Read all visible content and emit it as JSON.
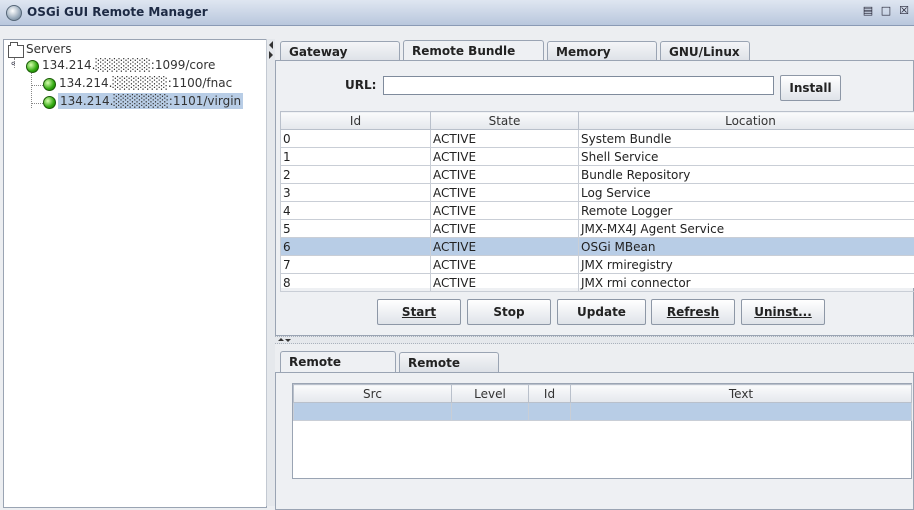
{
  "window": {
    "title": "OSGi GUI Remote Manager"
  },
  "tree": {
    "root_label": "Servers",
    "nodes": [
      {
        "label": "134.214.░░░░░░:1099/core"
      },
      {
        "label": "134.214.░░░░░░:1100/fnac"
      },
      {
        "label": "134.214.░░░░░░:1101/virgin"
      }
    ]
  },
  "tabs": [
    "Gateway Values",
    "Remote Bundle List",
    "Memory usage",
    "GNU/Linux"
  ],
  "url": {
    "label": "URL:",
    "value": "",
    "install_label": "Install"
  },
  "bundles": {
    "headers": [
      "Id",
      "State",
      "Location"
    ],
    "rows": [
      {
        "id": "0",
        "state": "ACTIVE",
        "location": "System Bundle"
      },
      {
        "id": "1",
        "state": "ACTIVE",
        "location": "Shell Service"
      },
      {
        "id": "2",
        "state": "ACTIVE",
        "location": "Bundle Repository"
      },
      {
        "id": "3",
        "state": "ACTIVE",
        "location": "Log Service"
      },
      {
        "id": "4",
        "state": "ACTIVE",
        "location": "Remote Logger"
      },
      {
        "id": "5",
        "state": "ACTIVE",
        "location": "JMX-MX4J Agent Service"
      },
      {
        "id": "6",
        "state": "ACTIVE",
        "location": "OSGi MBean"
      },
      {
        "id": "7",
        "state": "ACTIVE",
        "location": "JMX rmiregistry"
      },
      {
        "id": "8",
        "state": "ACTIVE",
        "location": "JMX rmi connector"
      }
    ]
  },
  "actions": {
    "start": "Start",
    "stop": "Stop",
    "update": "Update",
    "refresh": "Refresh",
    "uninstall": "Uninst..."
  },
  "bottom_tabs": [
    "Remote Logger",
    "Remote OBR"
  ],
  "log": {
    "headers": [
      "Src",
      "Level",
      "Id",
      "Text"
    ]
  }
}
